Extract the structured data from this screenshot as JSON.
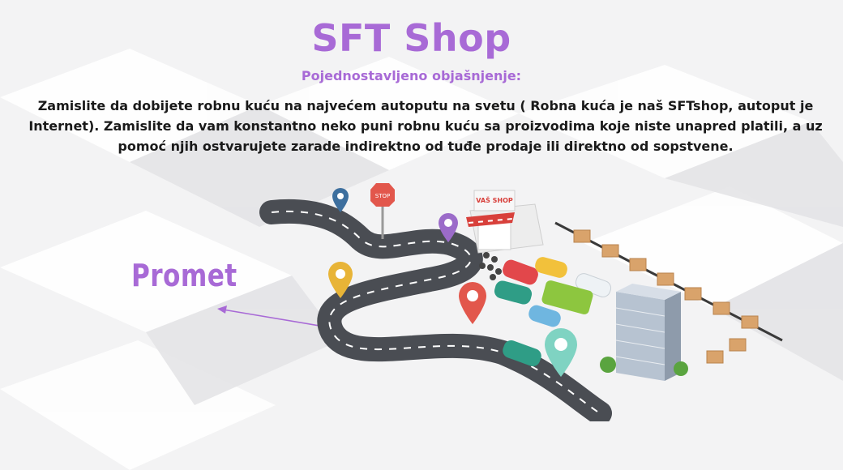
{
  "title": "SFT Shop",
  "subtitle": "Pojednostavljeno objašnjenje:",
  "description": "Zamislite da dobijete robnu kuću na najvećem autoputu na svetu ( Robna kuća je naš SFTshop, autoput je Internet). Zamislite da vam konstantno neko puni robnu kuću sa proizvodima koje niste unapred platili, a uz pomoć njih ostvarujete zarade indirektno od tuđe prodaje ili direktno od sopstvene.",
  "label_left": "Promet",
  "stop_sign": "STOP",
  "shop_sign": "VAŠ SHOP",
  "colors": {
    "accent": "#a86ad6",
    "text": "#1a1a1a",
    "road": "#4a4d53",
    "pin_blue": "#3d6f9e",
    "pin_purple": "#9b6bc9",
    "pin_yellow": "#e8b437",
    "pin_red": "#e2574c",
    "pin_teal": "#7fd3c2"
  }
}
